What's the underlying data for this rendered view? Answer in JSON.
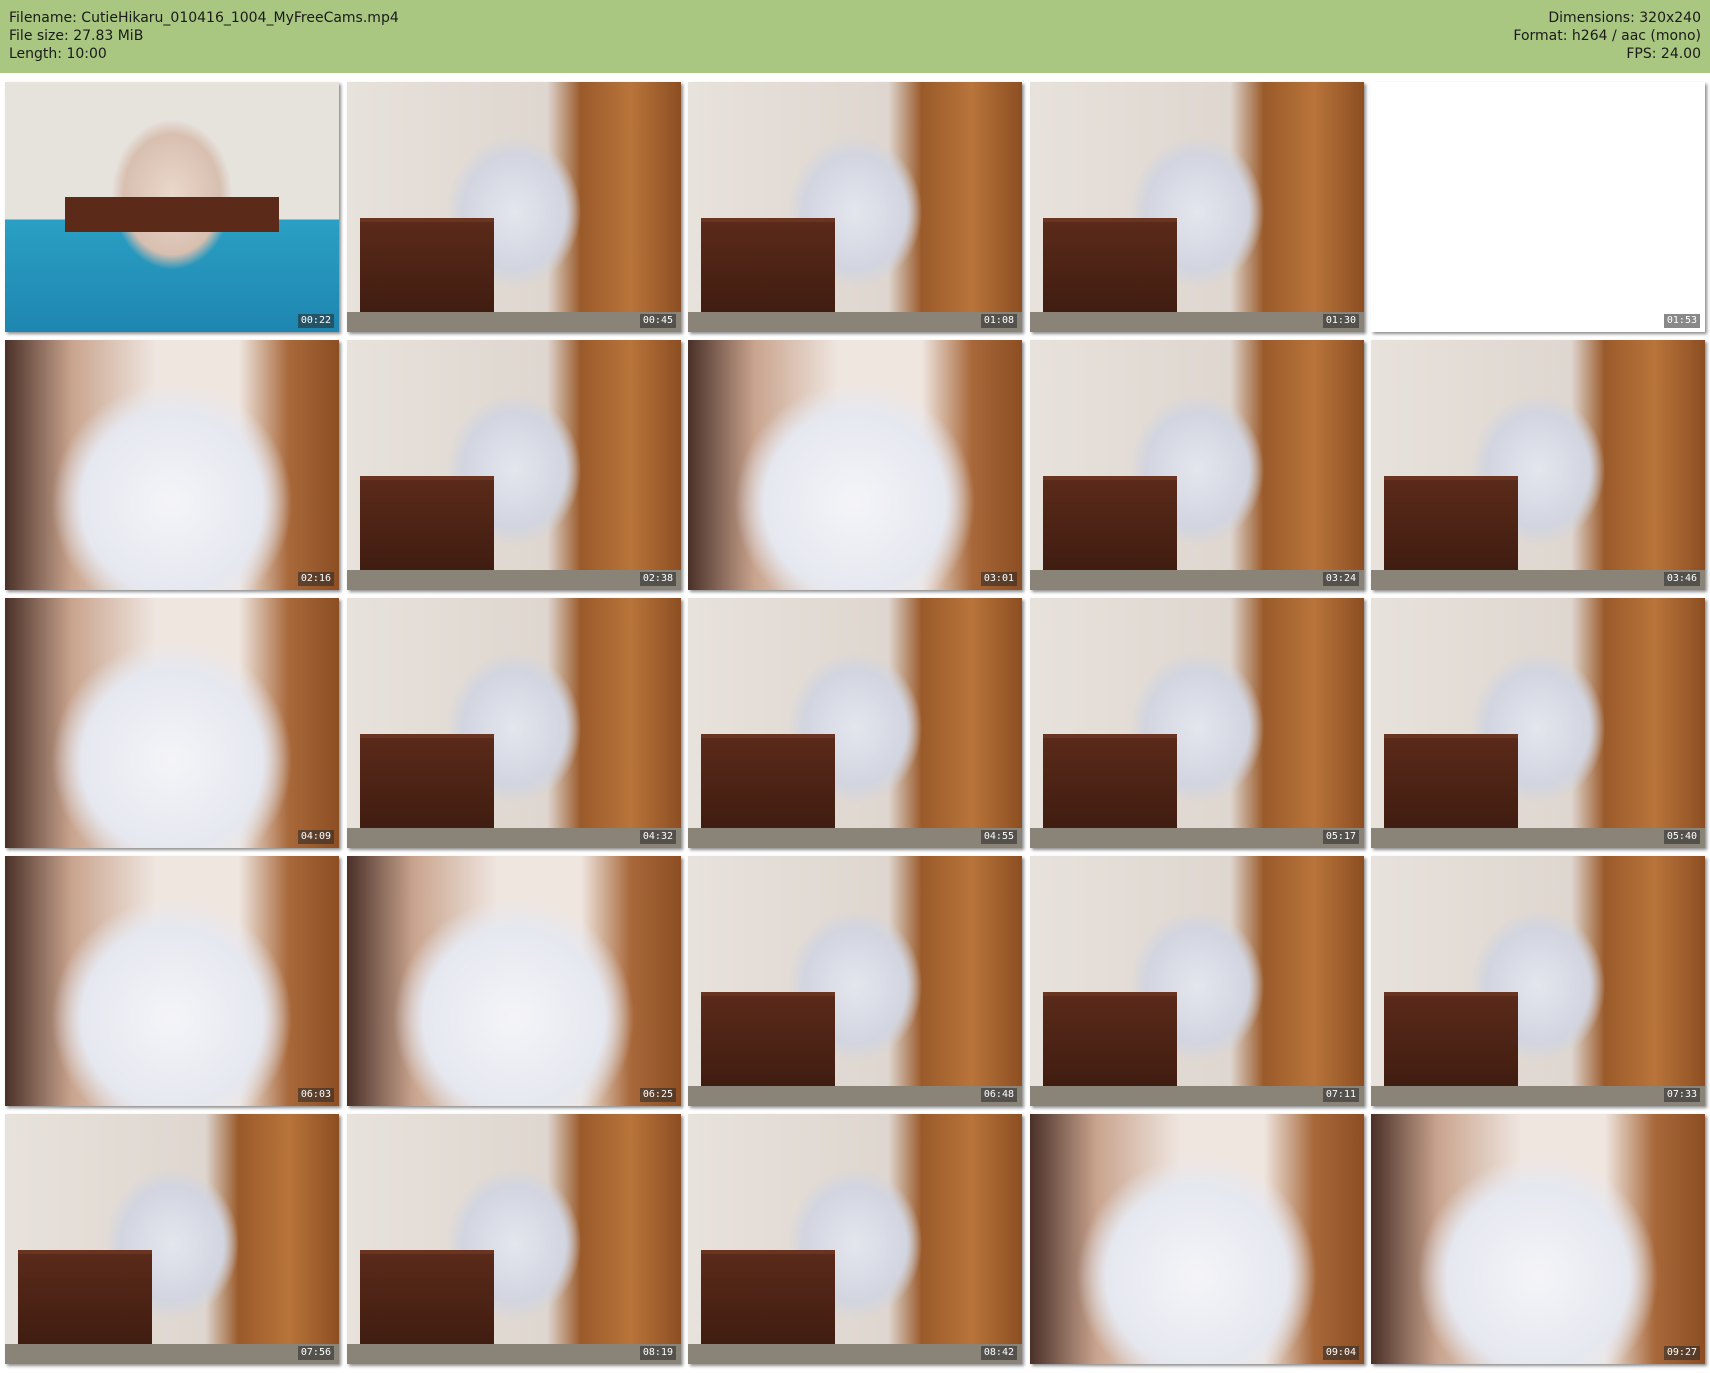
{
  "header": {
    "filename": "Filename: CutieHikaru_010416_1004_MyFreeCams.mp4",
    "file_size": "File size: 27.83 MiB",
    "length": "Length: 10:00",
    "dimensions": "Dimensions: 320x240",
    "format": "Format: h264 / aac (mono)",
    "fps": "FPS: 24.00"
  },
  "colors": {
    "header_bg": "#a9c781"
  },
  "thumbnails": [
    {
      "time": "00:22",
      "scene": "bedroom"
    },
    {
      "time": "00:45",
      "scene": "room"
    },
    {
      "time": "01:08",
      "scene": "room"
    },
    {
      "time": "01:30",
      "scene": "room"
    },
    {
      "time": "01:53",
      "scene": "white"
    },
    {
      "time": "02:16",
      "scene": "closeup"
    },
    {
      "time": "02:38",
      "scene": "room"
    },
    {
      "time": "03:01",
      "scene": "closeup"
    },
    {
      "time": "03:24",
      "scene": "room"
    },
    {
      "time": "03:46",
      "scene": "room"
    },
    {
      "time": "04:09",
      "scene": "closeup"
    },
    {
      "time": "04:32",
      "scene": "room"
    },
    {
      "time": "04:55",
      "scene": "room"
    },
    {
      "time": "05:17",
      "scene": "room"
    },
    {
      "time": "05:40",
      "scene": "room"
    },
    {
      "time": "06:03",
      "scene": "closeup"
    },
    {
      "time": "06:25",
      "scene": "closeup"
    },
    {
      "time": "06:48",
      "scene": "room"
    },
    {
      "time": "07:11",
      "scene": "room"
    },
    {
      "time": "07:33",
      "scene": "room"
    },
    {
      "time": "07:56",
      "scene": "room"
    },
    {
      "time": "08:19",
      "scene": "room"
    },
    {
      "time": "08:42",
      "scene": "room"
    },
    {
      "time": "09:04",
      "scene": "closeup"
    },
    {
      "time": "09:27",
      "scene": "closeup"
    }
  ]
}
